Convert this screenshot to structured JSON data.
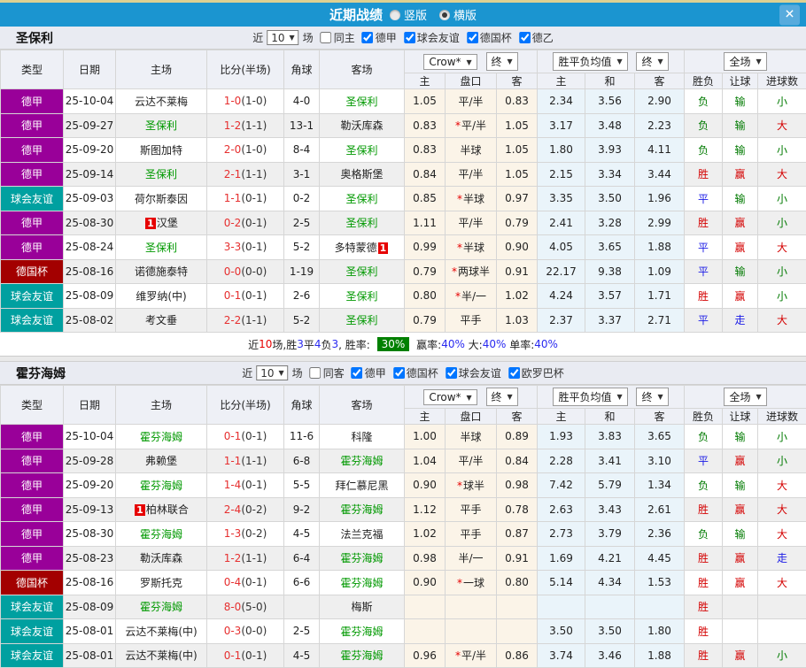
{
  "icons": {
    "dropdown_arrow": "▼",
    "close": "✕"
  },
  "colors": {
    "titlebar": "#1b95d0",
    "league_types": {
      "德甲": "#990099",
      "球会友谊": "#00a0a0",
      "德国杯": "#a30000"
    },
    "result_red": "#d40000",
    "result_blue": "#1a1ae6",
    "result_green": "#007a00",
    "team_highlight": "#009900",
    "score": "#e63030",
    "win_rate_badge_bg": "#008000"
  },
  "titlebar": {
    "title": "近期战绩",
    "radios": [
      {
        "label": "竖版",
        "selected": false
      },
      {
        "label": "横版",
        "selected": true
      }
    ]
  },
  "columns": {
    "main": [
      "类型",
      "日期",
      "主场",
      "比分(半场)",
      "角球",
      "客场"
    ],
    "odds_sub": [
      "主",
      "盘口",
      "客"
    ],
    "avg_sub": [
      "主",
      "和",
      "客"
    ],
    "result_sub": [
      "胜负",
      "让球",
      "进球数"
    ],
    "dropdowns": {
      "bookmaker": "Crow*",
      "odds_stage": "终",
      "avg": "胜平负均值",
      "avg_stage": "终",
      "scope": "全场"
    }
  },
  "sections": [
    {
      "team": "圣保利",
      "filter": {
        "near": "近",
        "count": "10",
        "games": "场",
        "same": {
          "label": "同主",
          "checked": false
        },
        "leagues": [
          {
            "label": "德甲",
            "checked": true
          },
          {
            "label": "球会友谊",
            "checked": true
          },
          {
            "label": "德国杯",
            "checked": true
          },
          {
            "label": "德乙",
            "checked": true
          }
        ]
      },
      "rows": [
        {
          "type": "德甲",
          "date": "25-10-04",
          "home": {
            "name": "云达不莱梅"
          },
          "score": "1-0",
          "half": "(1-0)",
          "corner": "4-0",
          "away": {
            "name": "圣保利",
            "green": true
          },
          "star": false,
          "odds": [
            "1.05",
            "平/半",
            "0.83"
          ],
          "avg": [
            "2.34",
            "3.56",
            "2.90"
          ],
          "results": [
            [
              "负",
              "green"
            ],
            [
              "输",
              "green"
            ],
            [
              "小",
              "green"
            ]
          ]
        },
        {
          "type": "德甲",
          "date": "25-09-27",
          "home": {
            "name": "圣保利",
            "green": true
          },
          "score": "1-2",
          "half": "(1-1)",
          "corner": "13-1",
          "away": {
            "name": "勒沃库森"
          },
          "star": true,
          "odds": [
            "0.83",
            "平/半",
            "1.05"
          ],
          "avg": [
            "3.17",
            "3.48",
            "2.23"
          ],
          "results": [
            [
              "负",
              "green"
            ],
            [
              "输",
              "green"
            ],
            [
              "大",
              "red"
            ]
          ]
        },
        {
          "type": "德甲",
          "date": "25-09-20",
          "home": {
            "name": "斯图加特"
          },
          "score": "2-0",
          "half": "(1-0)",
          "corner": "8-4",
          "away": {
            "name": "圣保利",
            "green": true
          },
          "star": false,
          "odds": [
            "0.83",
            "半球",
            "1.05"
          ],
          "avg": [
            "1.80",
            "3.93",
            "4.11"
          ],
          "results": [
            [
              "负",
              "green"
            ],
            [
              "输",
              "green"
            ],
            [
              "小",
              "green"
            ]
          ]
        },
        {
          "type": "德甲",
          "date": "25-09-14",
          "home": {
            "name": "圣保利",
            "green": true
          },
          "score": "2-1",
          "half": "(1-1)",
          "corner": "3-1",
          "away": {
            "name": "奥格斯堡"
          },
          "star": false,
          "odds": [
            "0.84",
            "平/半",
            "1.05"
          ],
          "avg": [
            "2.15",
            "3.34",
            "3.44"
          ],
          "results": [
            [
              "胜",
              "red"
            ],
            [
              "赢",
              "red"
            ],
            [
              "大",
              "red"
            ]
          ]
        },
        {
          "type": "球会友谊",
          "date": "25-09-03",
          "home": {
            "name": "荷尔斯泰因"
          },
          "score": "1-1",
          "half": "(0-1)",
          "corner": "0-2",
          "away": {
            "name": "圣保利",
            "green": true
          },
          "star": true,
          "odds": [
            "0.85",
            "半球",
            "0.97"
          ],
          "avg": [
            "3.35",
            "3.50",
            "1.96"
          ],
          "results": [
            [
              "平",
              "blue"
            ],
            [
              "输",
              "green"
            ],
            [
              "小",
              "green"
            ]
          ]
        },
        {
          "type": "德甲",
          "date": "25-08-30",
          "home": {
            "name": "汉堡",
            "badge_pre": "1"
          },
          "score": "0-2",
          "half": "(0-1)",
          "corner": "2-5",
          "away": {
            "name": "圣保利",
            "green": true
          },
          "star": false,
          "odds": [
            "1.11",
            "平/半",
            "0.79"
          ],
          "avg": [
            "2.41",
            "3.28",
            "2.99"
          ],
          "results": [
            [
              "胜",
              "red"
            ],
            [
              "赢",
              "red"
            ],
            [
              "小",
              "green"
            ]
          ]
        },
        {
          "type": "德甲",
          "date": "25-08-24",
          "home": {
            "name": "圣保利",
            "green": true
          },
          "score": "3-3",
          "half": "(0-1)",
          "corner": "5-2",
          "away": {
            "name": "多特蒙德",
            "badge_post": "1"
          },
          "star": true,
          "odds": [
            "0.99",
            "半球",
            "0.90"
          ],
          "avg": [
            "4.05",
            "3.65",
            "1.88"
          ],
          "results": [
            [
              "平",
              "blue"
            ],
            [
              "赢",
              "red"
            ],
            [
              "大",
              "red"
            ]
          ]
        },
        {
          "type": "德国杯",
          "date": "25-08-16",
          "home": {
            "name": "诺德施泰特"
          },
          "score": "0-0",
          "half": "(0-0)",
          "corner": "1-19",
          "away": {
            "name": "圣保利",
            "green": true
          },
          "star": true,
          "odds": [
            "0.79",
            "两球半",
            "0.91"
          ],
          "avg": [
            "22.17",
            "9.38",
            "1.09"
          ],
          "results": [
            [
              "平",
              "blue"
            ],
            [
              "输",
              "green"
            ],
            [
              "小",
              "green"
            ]
          ]
        },
        {
          "type": "球会友谊",
          "date": "25-08-09",
          "home": {
            "name": "维罗纳(中)"
          },
          "score": "0-1",
          "half": "(0-1)",
          "corner": "2-6",
          "away": {
            "name": "圣保利",
            "green": true
          },
          "star": true,
          "odds": [
            "0.80",
            "半/一",
            "1.02"
          ],
          "avg": [
            "4.24",
            "3.57",
            "1.71"
          ],
          "results": [
            [
              "胜",
              "red"
            ],
            [
              "赢",
              "red"
            ],
            [
              "小",
              "green"
            ]
          ]
        },
        {
          "type": "球会友谊",
          "date": "25-08-02",
          "home": {
            "name": "考文垂"
          },
          "score": "2-2",
          "half": "(1-1)",
          "corner": "5-2",
          "away": {
            "name": "圣保利",
            "green": true
          },
          "star": false,
          "odds": [
            "0.79",
            "平手",
            "1.03"
          ],
          "avg": [
            "2.37",
            "3.37",
            "2.71"
          ],
          "results": [
            [
              "平",
              "blue"
            ],
            [
              "走",
              "blue"
            ],
            [
              "大",
              "red"
            ]
          ]
        }
      ],
      "summary": {
        "segments": [
          {
            "t": "近"
          },
          {
            "t": "10",
            "c": "red"
          },
          {
            "t": "场,胜"
          },
          {
            "t": "3",
            "c": "blue"
          },
          {
            "t": "平"
          },
          {
            "t": "4",
            "c": "blue"
          },
          {
            "t": "负"
          },
          {
            "t": "3",
            "c": "blue"
          },
          {
            "t": ", 胜率: "
          },
          {
            "t": "30%",
            "c": "badge"
          },
          {
            "t": " 赢率:"
          },
          {
            "t": "40%",
            "c": "blue"
          },
          {
            "t": " 大:"
          },
          {
            "t": "40%",
            "c": "blue"
          },
          {
            "t": " 单率:"
          },
          {
            "t": "40%",
            "c": "blue"
          }
        ]
      }
    },
    {
      "team": "霍芬海姆",
      "filter": {
        "near": "近",
        "count": "10",
        "games": "场",
        "same": {
          "label": "同客",
          "checked": false
        },
        "leagues": [
          {
            "label": "德甲",
            "checked": true
          },
          {
            "label": "德国杯",
            "checked": true
          },
          {
            "label": "球会友谊",
            "checked": true
          },
          {
            "label": "欧罗巴杯",
            "checked": true
          }
        ]
      },
      "rows": [
        {
          "type": "德甲",
          "date": "25-10-04",
          "home": {
            "name": "霍芬海姆",
            "green": true
          },
          "score": "0-1",
          "half": "(0-1)",
          "corner": "11-6",
          "away": {
            "name": "科隆"
          },
          "star": false,
          "odds": [
            "1.00",
            "半球",
            "0.89"
          ],
          "avg": [
            "1.93",
            "3.83",
            "3.65"
          ],
          "results": [
            [
              "负",
              "green"
            ],
            [
              "输",
              "green"
            ],
            [
              "小",
              "green"
            ]
          ]
        },
        {
          "type": "德甲",
          "date": "25-09-28",
          "home": {
            "name": "弗赖堡"
          },
          "score": "1-1",
          "half": "(1-1)",
          "corner": "6-8",
          "away": {
            "name": "霍芬海姆",
            "green": true
          },
          "star": false,
          "odds": [
            "1.04",
            "平/半",
            "0.84"
          ],
          "avg": [
            "2.28",
            "3.41",
            "3.10"
          ],
          "results": [
            [
              "平",
              "blue"
            ],
            [
              "赢",
              "red"
            ],
            [
              "小",
              "green"
            ]
          ]
        },
        {
          "type": "德甲",
          "date": "25-09-20",
          "home": {
            "name": "霍芬海姆",
            "green": true
          },
          "score": "1-4",
          "half": "(0-1)",
          "corner": "5-5",
          "away": {
            "name": "拜仁慕尼黑"
          },
          "star": true,
          "odds": [
            "0.90",
            "球半",
            "0.98"
          ],
          "avg": [
            "7.42",
            "5.79",
            "1.34"
          ],
          "results": [
            [
              "负",
              "green"
            ],
            [
              "输",
              "green"
            ],
            [
              "大",
              "red"
            ]
          ]
        },
        {
          "type": "德甲",
          "date": "25-09-13",
          "home": {
            "name": "柏林联合",
            "badge_pre": "1"
          },
          "score": "2-4",
          "half": "(0-2)",
          "corner": "9-2",
          "away": {
            "name": "霍芬海姆",
            "green": true
          },
          "star": false,
          "odds": [
            "1.12",
            "平手",
            "0.78"
          ],
          "avg": [
            "2.63",
            "3.43",
            "2.61"
          ],
          "results": [
            [
              "胜",
              "red"
            ],
            [
              "赢",
              "red"
            ],
            [
              "大",
              "red"
            ]
          ]
        },
        {
          "type": "德甲",
          "date": "25-08-30",
          "home": {
            "name": "霍芬海姆",
            "green": true
          },
          "score": "1-3",
          "half": "(0-2)",
          "corner": "4-5",
          "away": {
            "name": "法兰克福"
          },
          "star": false,
          "odds": [
            "1.02",
            "平手",
            "0.87"
          ],
          "avg": [
            "2.73",
            "3.79",
            "2.36"
          ],
          "results": [
            [
              "负",
              "green"
            ],
            [
              "输",
              "green"
            ],
            [
              "大",
              "red"
            ]
          ]
        },
        {
          "type": "德甲",
          "date": "25-08-23",
          "home": {
            "name": "勒沃库森"
          },
          "score": "1-2",
          "half": "(1-1)",
          "corner": "6-4",
          "away": {
            "name": "霍芬海姆",
            "green": true
          },
          "star": false,
          "odds": [
            "0.98",
            "半/一",
            "0.91"
          ],
          "avg": [
            "1.69",
            "4.21",
            "4.45"
          ],
          "results": [
            [
              "胜",
              "red"
            ],
            [
              "赢",
              "red"
            ],
            [
              "走",
              "blue"
            ]
          ]
        },
        {
          "type": "德国杯",
          "date": "25-08-16",
          "home": {
            "name": "罗斯托克"
          },
          "score": "0-4",
          "half": "(0-1)",
          "corner": "6-6",
          "away": {
            "name": "霍芬海姆",
            "green": true
          },
          "star": true,
          "odds": [
            "0.90",
            "一球",
            "0.80"
          ],
          "avg": [
            "5.14",
            "4.34",
            "1.53"
          ],
          "results": [
            [
              "胜",
              "red"
            ],
            [
              "赢",
              "red"
            ],
            [
              "大",
              "red"
            ]
          ]
        },
        {
          "type": "球会友谊",
          "date": "25-08-09",
          "home": {
            "name": "霍芬海姆",
            "green": true
          },
          "score": "8-0",
          "half": "(5-0)",
          "corner": "",
          "away": {
            "name": "梅斯"
          },
          "star": false,
          "odds": [
            "",
            "",
            ""
          ],
          "avg": [
            "",
            "",
            ""
          ],
          "results": [
            [
              "胜",
              "red"
            ],
            [
              "",
              ""
            ],
            [
              "",
              ""
            ]
          ]
        },
        {
          "type": "球会友谊",
          "date": "25-08-01",
          "home": {
            "name": "云达不莱梅(中)"
          },
          "score": "0-3",
          "half": "(0-0)",
          "corner": "2-5",
          "away": {
            "name": "霍芬海姆",
            "green": true
          },
          "star": false,
          "odds": [
            "",
            "",
            ""
          ],
          "avg": [
            "3.50",
            "3.50",
            "1.80"
          ],
          "results": [
            [
              "胜",
              "red"
            ],
            [
              "",
              ""
            ],
            [
              "",
              ""
            ]
          ]
        },
        {
          "type": "球会友谊",
          "date": "25-08-01",
          "home": {
            "name": "云达不莱梅(中)"
          },
          "score": "0-1",
          "half": "(0-1)",
          "corner": "4-5",
          "away": {
            "name": "霍芬海姆",
            "green": true
          },
          "star": true,
          "odds": [
            "0.96",
            "平/半",
            "0.86"
          ],
          "avg": [
            "3.74",
            "3.46",
            "1.88"
          ],
          "results": [
            [
              "胜",
              "red"
            ],
            [
              "赢",
              "red"
            ],
            [
              "小",
              "green"
            ]
          ]
        }
      ]
    }
  ]
}
